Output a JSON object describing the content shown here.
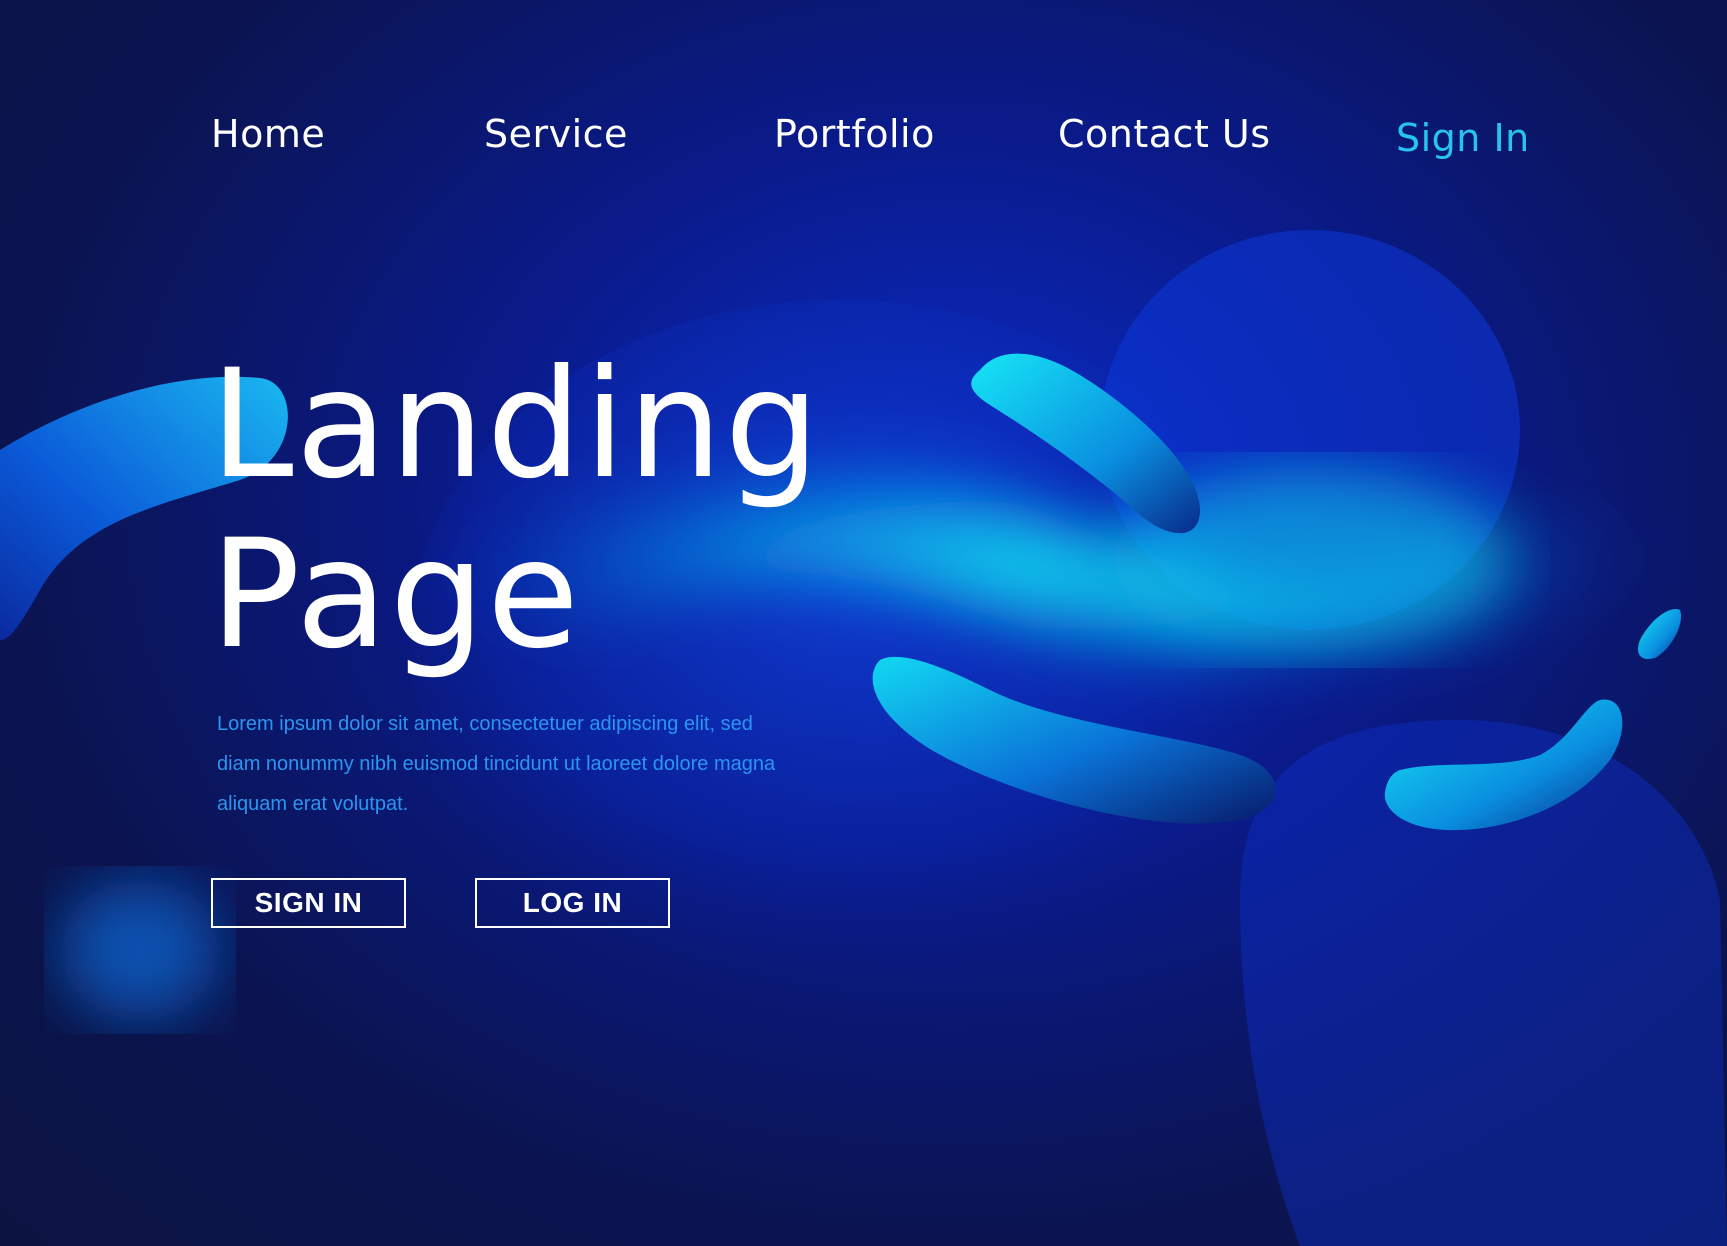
{
  "nav": {
    "items": [
      {
        "label": "Home"
      },
      {
        "label": "Service"
      },
      {
        "label": "Portfolio"
      },
      {
        "label": "Contact Us"
      }
    ],
    "sign_in": "Sign In",
    "sign_in_color": "#26c4ee"
  },
  "hero": {
    "title_line1": "Landing",
    "title_line2": "Page",
    "description": "Lorem ipsum dolor sit amet, consectetuer adipiscing elit, sed diam nonummy nibh euismod tincidunt ut laoreet dolore magna aliquam erat volutpat.",
    "description_color": "#2c95f0"
  },
  "buttons": {
    "sign_in": "SIGN IN",
    "log_in": "LOG IN"
  },
  "colors": {
    "background": "#0b1440",
    "accent_cyan": "#14d8f0",
    "accent_blue": "#0a2cc8"
  }
}
